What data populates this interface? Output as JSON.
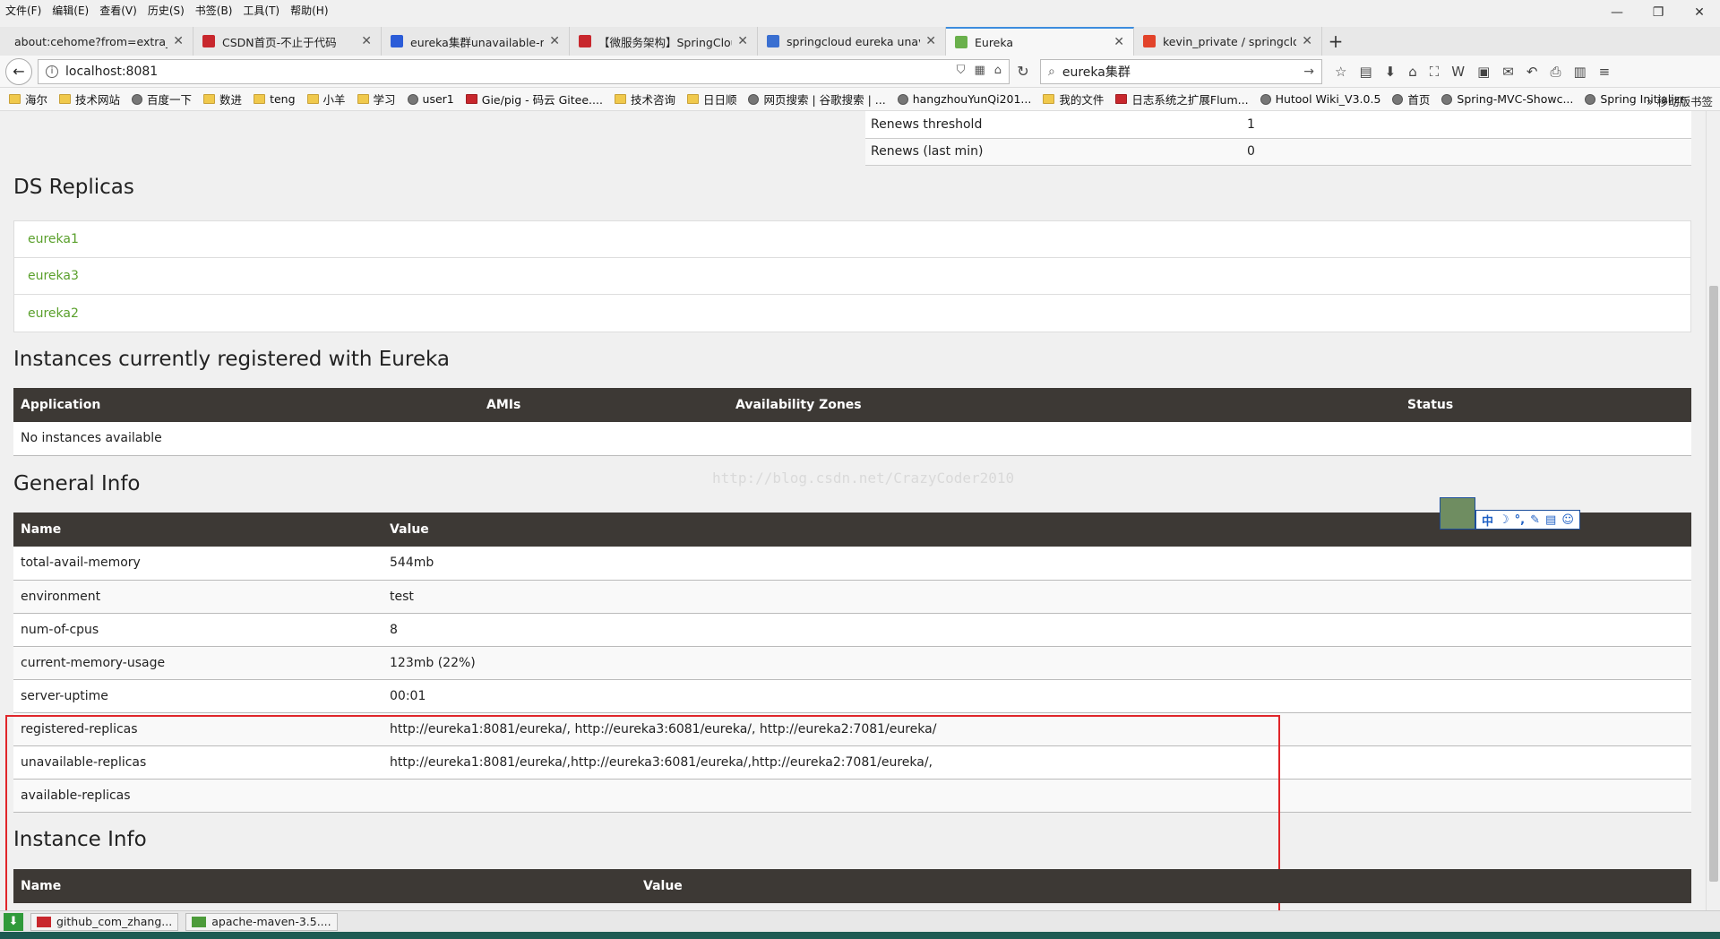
{
  "menu": [
    "文件(F)",
    "编辑(E)",
    "查看(V)",
    "历史(S)",
    "书签(B)",
    "工具(T)",
    "帮助(H)"
  ],
  "window_controls": {
    "minimize": "—",
    "restore": "❐",
    "close": "✕"
  },
  "tabs": [
    {
      "label": "about:cehome?from=extra_st",
      "icon": "none",
      "color": ""
    },
    {
      "label": "CSDN首页-不止于代码",
      "icon": "csdn-icon",
      "color": "#c8272d"
    },
    {
      "label": "eureka集群unavailable-rep",
      "icon": "baidu-icon",
      "color": "#2b5cd8"
    },
    {
      "label": "【微服务架构】SpringClou",
      "icon": "csdn-icon",
      "color": "#c8272d"
    },
    {
      "label": "springcloud eureka unava",
      "icon": "google-icon",
      "color": "#3a6fd1"
    },
    {
      "label": "Eureka",
      "icon": "leaf-icon",
      "color": "#6ab04c"
    },
    {
      "label": "kevin_private / springclou",
      "icon": "gitlab-icon",
      "color": "#e2432a"
    }
  ],
  "nav": {
    "url": "localhost:8081",
    "search": "eureka集群"
  },
  "bookmarks": [
    "海尔",
    "技术网站",
    "百度一下",
    "数进",
    "teng",
    "小羊",
    "学习",
    "user1",
    "Gie/pig - 码云 Gitee....",
    "技术咨询",
    "日日顺",
    "网页搜索 | 谷歌搜索 | ...",
    "hangzhouYunQi201...",
    "我的文件",
    "日志系统之扩展Flum...",
    "Hutool Wiki_V3.0.5",
    "首页",
    "Spring-MVC-Showc...",
    "Spring Initializr"
  ],
  "bookmark_types": [
    "folder",
    "folder",
    "globe",
    "folder",
    "folder",
    "folder",
    "folder",
    "globe",
    "red",
    "folder",
    "folder",
    "globe",
    "globe",
    "folder",
    "red",
    "globe",
    "globe",
    "globe",
    "globe"
  ],
  "bookmarks_more": "» 移动版书签",
  "renews": [
    {
      "name": "Renews threshold",
      "value": "1"
    },
    {
      "name": "Renews (last min)",
      "value": "0"
    }
  ],
  "ds_replicas": {
    "title": "DS Replicas",
    "items": [
      "eureka1",
      "eureka3",
      "eureka2"
    ]
  },
  "instances": {
    "title": "Instances currently registered with Eureka",
    "headers": [
      "Application",
      "AMIs",
      "Availability Zones",
      "Status"
    ],
    "empty": "No instances available"
  },
  "general_info": {
    "title": "General Info",
    "headers": [
      "Name",
      "Value"
    ],
    "rows": [
      {
        "name": "total-avail-memory",
        "value": "544mb"
      },
      {
        "name": "environment",
        "value": "test"
      },
      {
        "name": "num-of-cpus",
        "value": "8"
      },
      {
        "name": "current-memory-usage",
        "value": "123mb (22%)"
      },
      {
        "name": "server-uptime",
        "value": "00:01"
      },
      {
        "name": "registered-replicas",
        "value": "http://eureka1:8081/eureka/, http://eureka3:6081/eureka/, http://eureka2:7081/eureka/"
      },
      {
        "name": "unavailable-replicas",
        "value": "http://eureka1:8081/eureka/,http://eureka3:6081/eureka/,http://eureka2:7081/eureka/,"
      },
      {
        "name": "available-replicas",
        "value": ""
      }
    ]
  },
  "instance_info": {
    "title": "Instance Info",
    "headers": [
      "Name",
      "Value"
    ]
  },
  "watermark": "http://blog.csdn.net/CrazyCoder2010",
  "ime_toolbar": [
    "中",
    "☽",
    "°,",
    "✎",
    "▤",
    "☺"
  ],
  "status_tasks": [
    {
      "label": "github_com_zhang...",
      "icon": "pdf-icon"
    },
    {
      "label": "apache-maven-3.5....",
      "icon": "archive-icon"
    }
  ],
  "colors": {
    "link": "#5aa02c",
    "table_header": "#3d3935",
    "highlight_box": "#e0262a",
    "active_tab": "#3c8dde"
  }
}
